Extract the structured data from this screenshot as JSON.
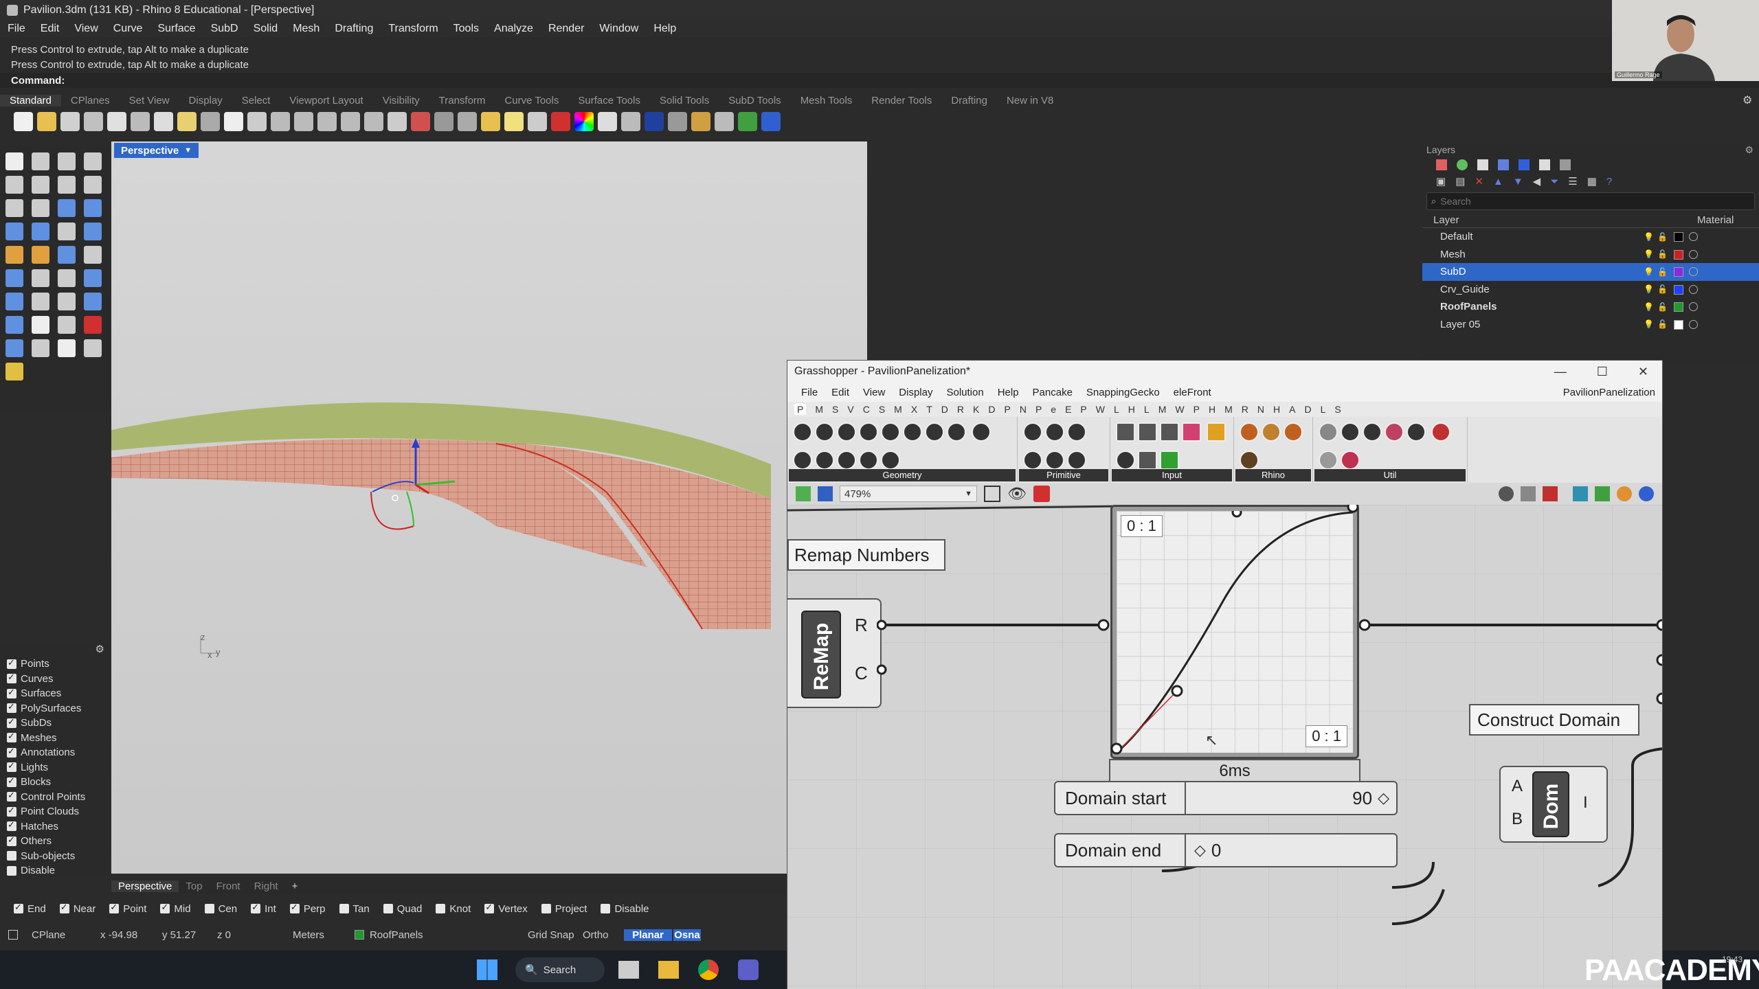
{
  "app": {
    "title": "Pavilion.3dm (131 KB) - Rhino 8 Educational - [Perspective]",
    "menu": [
      "File",
      "Edit",
      "View",
      "Curve",
      "Surface",
      "SubD",
      "Solid",
      "Mesh",
      "Drafting",
      "Transform",
      "Tools",
      "Analyze",
      "Render",
      "Window",
      "Help"
    ],
    "command_history": [
      "Press Control to extrude, tap Alt to make a duplicate",
      "Press Control to extrude, tap Alt to make a duplicate"
    ],
    "command_prompt": "Command:"
  },
  "toolbar_tabs": [
    "Standard",
    "CPlanes",
    "Set View",
    "Display",
    "Select",
    "Viewport Layout",
    "Visibility",
    "Transform",
    "Curve Tools",
    "Surface Tools",
    "Solid Tools",
    "SubD Tools",
    "Mesh Tools",
    "Render Tools",
    "Drafting",
    "New in V8"
  ],
  "viewport": {
    "name": "Perspective",
    "axis_z": "z",
    "axis_x": "x",
    "axis_y": "y"
  },
  "viewport_tabs": [
    "Perspective",
    "Top",
    "Front",
    "Right",
    "+"
  ],
  "object_filters": [
    {
      "label": "Points",
      "checked": true
    },
    {
      "label": "Curves",
      "checked": true
    },
    {
      "label": "Surfaces",
      "checked": true
    },
    {
      "label": "PolySurfaces",
      "checked": true
    },
    {
      "label": "SubDs",
      "checked": true
    },
    {
      "label": "Meshes",
      "checked": true
    },
    {
      "label": "Annotations",
      "checked": true
    },
    {
      "label": "Lights",
      "checked": true
    },
    {
      "label": "Blocks",
      "checked": true
    },
    {
      "label": "Control Points",
      "checked": true
    },
    {
      "label": "Point Clouds",
      "checked": true
    },
    {
      "label": "Hatches",
      "checked": true
    },
    {
      "label": "Others",
      "checked": true
    },
    {
      "label": "Sub-objects",
      "checked": false
    },
    {
      "label": "Disable",
      "checked": false
    }
  ],
  "osnap": [
    {
      "label": "End",
      "checked": true
    },
    {
      "label": "Near",
      "checked": true
    },
    {
      "label": "Point",
      "checked": true
    },
    {
      "label": "Mid",
      "checked": true
    },
    {
      "label": "Cen",
      "checked": false
    },
    {
      "label": "Int",
      "checked": true
    },
    {
      "label": "Perp",
      "checked": true
    },
    {
      "label": "Tan",
      "checked": false
    },
    {
      "label": "Quad",
      "checked": false
    },
    {
      "label": "Knot",
      "checked": false
    },
    {
      "label": "Vertex",
      "checked": true
    },
    {
      "label": "Project",
      "checked": false
    },
    {
      "label": "Disable",
      "checked": false
    }
  ],
  "status": {
    "cplane": "CPlane",
    "x": "x -94.98",
    "y": "y 51.27",
    "z": "z 0",
    "units": "Meters",
    "layer": "RoofPanels",
    "grid_snap": "Grid Snap",
    "ortho": "Ortho",
    "planar": "Planar",
    "osnap": "Osna"
  },
  "layers": {
    "title": "Layers",
    "search_placeholder": "Search",
    "col_layer": "Layer",
    "col_material": "Material",
    "rows": [
      {
        "name": "Default",
        "color": "#000000",
        "selected": false,
        "bold": false
      },
      {
        "name": "Mesh",
        "color": "#d01f1f",
        "selected": false,
        "bold": false
      },
      {
        "name": "SubD",
        "color": "#8a2be2",
        "selected": true,
        "bold": false
      },
      {
        "name": "Crv_Guide",
        "color": "#2040ff",
        "selected": false,
        "bold": false
      },
      {
        "name": "RoofPanels",
        "color": "#1f9a2f",
        "selected": false,
        "bold": true
      },
      {
        "name": "Layer 05",
        "color": "#ffffff",
        "selected": false,
        "bold": false
      }
    ]
  },
  "grasshopper": {
    "title": "Grasshopper - PavilionPanelization*",
    "menu": [
      "File",
      "Edit",
      "View",
      "Display",
      "Solution",
      "Help",
      "Pancake",
      "SnappingGecko",
      "eleFront"
    ],
    "doc_name": "PavilionPanelization",
    "tabs": [
      "P",
      "M",
      "S",
      "V",
      "C",
      "S",
      "M",
      "X",
      "T",
      "D",
      "R",
      "K",
      "D",
      "P",
      "N",
      "P",
      "e",
      "E",
      "P",
      "W",
      "L",
      "H",
      "L",
      "M",
      "W",
      "P",
      "H",
      "M",
      "R",
      "N",
      "H",
      "A",
      "D",
      "L",
      "S"
    ],
    "groups": [
      "Geometry",
      "Primitive",
      "Input",
      "Rhino",
      "Util"
    ],
    "zoom": "479%",
    "remap_label": "Remap Numbers",
    "remap_name": "ReMap",
    "remap_out_r": "R",
    "remap_out_c": "C",
    "graph_label_tl": "0 : 1",
    "graph_label_br": "0 : 1",
    "timing": "6ms",
    "domain_start_label": "Domain start",
    "domain_start_value": "90",
    "domain_end_label": "Domain end",
    "domain_end_value": "0",
    "construct_domain_label": "Construct Domain",
    "dom_name": "Dom",
    "dom_in_a": "A",
    "dom_in_b": "B",
    "dom_out_i": "I"
  },
  "taskbar": {
    "search": "Search",
    "time": "19:43"
  },
  "webcam_name": "Guillermo Rage",
  "watermark": "PAACADEMY"
}
